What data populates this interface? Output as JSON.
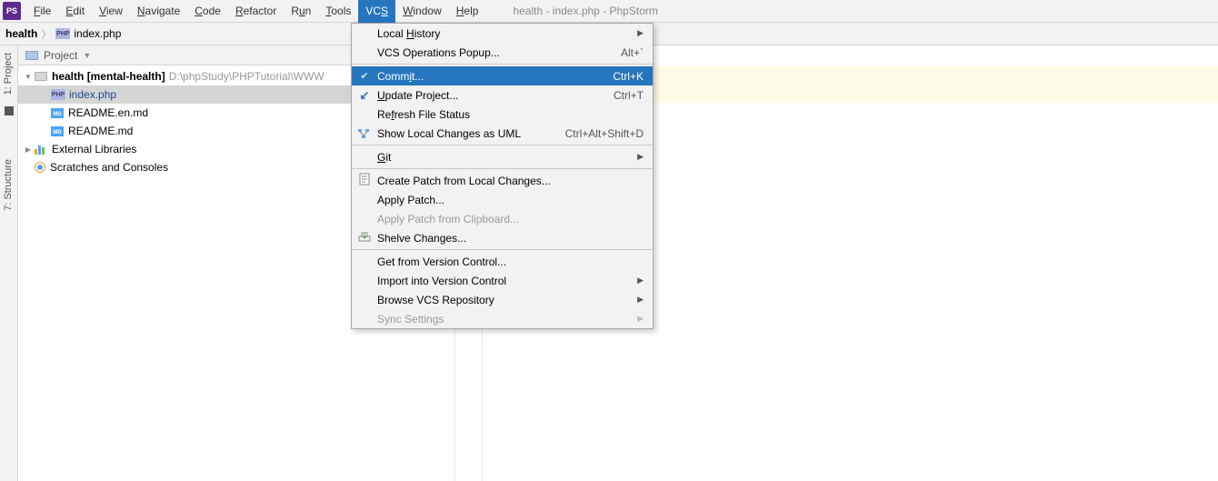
{
  "app_icon_text": "PS",
  "menu": {
    "file": "File",
    "edit": "Edit",
    "view": "View",
    "navigate": "Navigate",
    "code": "Code",
    "refactor": "Refactor",
    "run": "Run",
    "tools": "Tools",
    "vcs": "VCS",
    "window": "Window",
    "help": "Help"
  },
  "window_title": "health - index.php - PhpStorm",
  "breadcrumb": {
    "root": "health",
    "file": "index.php"
  },
  "left_tabs": {
    "project": "1: Project",
    "structure": "7: Structure"
  },
  "tool_window": {
    "title": "Project"
  },
  "tree": {
    "project_name": "health",
    "project_label_suffix": "[mental-health]",
    "project_path": "D:\\phpStudy\\PHPTutorial\\WWW",
    "files": {
      "index": "index.php",
      "readme_en": "README.en.md",
      "readme": "README.md"
    },
    "external_libs": "External Libraries",
    "scratches": "Scratches and Consoles"
  },
  "vcs_menu": {
    "local_history": "Local History",
    "vcs_ops": "VCS Operations Popup...",
    "vcs_ops_short": "Alt+`",
    "commit": "Commit...",
    "commit_short": "Ctrl+K",
    "update": "Update Project...",
    "update_short": "Ctrl+T",
    "refresh": "Refresh File Status",
    "uml": "Show Local Changes as UML",
    "uml_short": "Ctrl+Alt+Shift+D",
    "git": "Git",
    "create_patch": "Create Patch from Local Changes...",
    "apply_patch": "Apply Patch...",
    "apply_clip": "Apply Patch from Clipboard...",
    "shelve": "Shelve Changes...",
    "get_vc": "Get from Version Control...",
    "import_vc": "Import into Version Control",
    "browse_repo": "Browse VCS Repository",
    "sync": "Sync Settings"
  }
}
